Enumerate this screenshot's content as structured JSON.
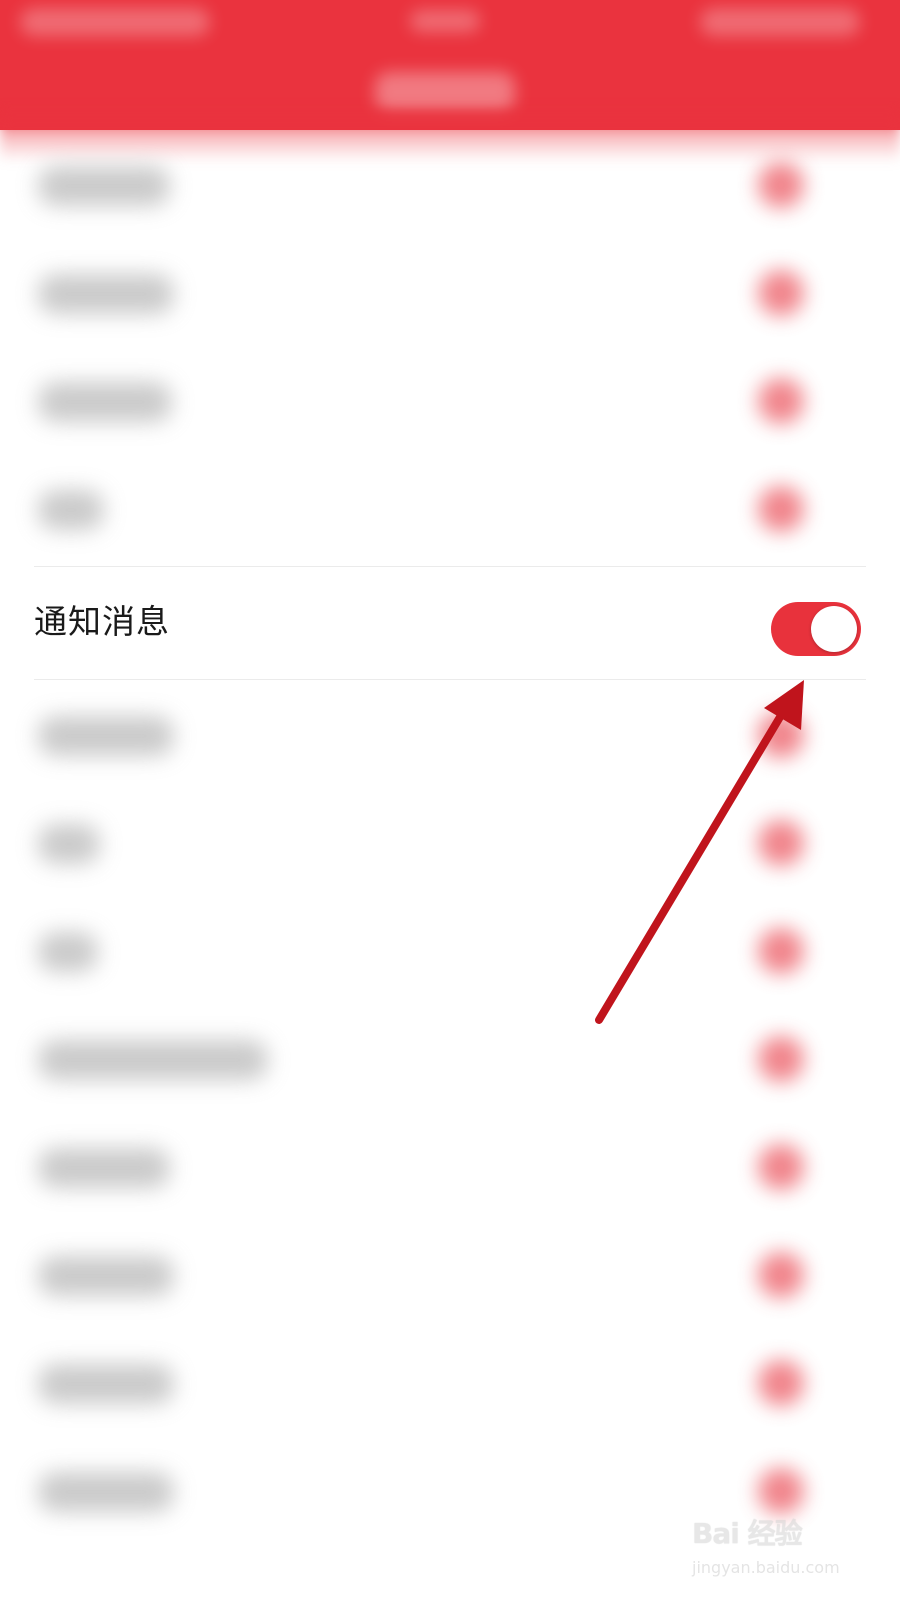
{
  "app": {
    "accent_color": "#e8323c",
    "header_color": "#ea333e"
  },
  "settings": {
    "notification": {
      "label": "通知消息",
      "toggle_on": true
    }
  },
  "watermark": {
    "brand": "Bai  经验",
    "site": "jingyan.baidu.com"
  }
}
